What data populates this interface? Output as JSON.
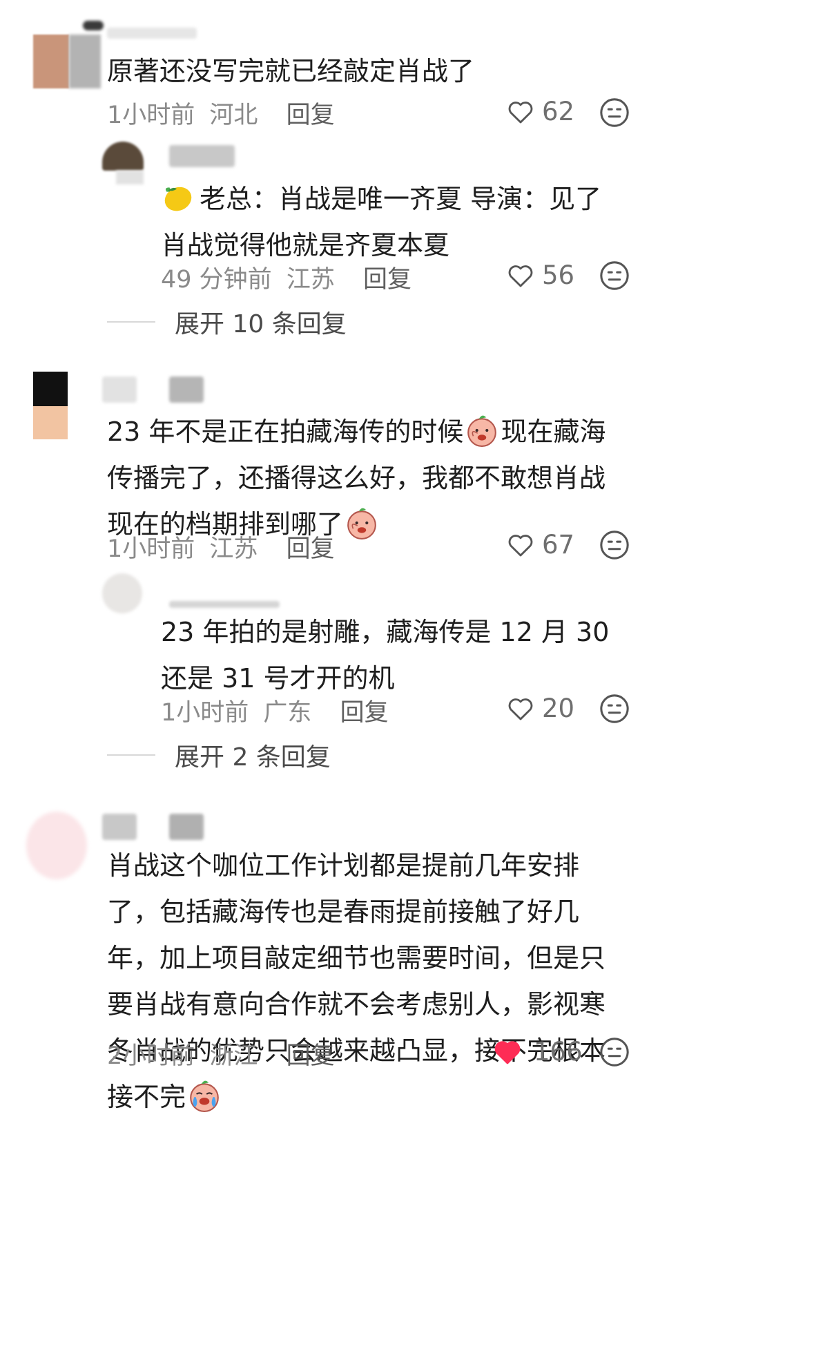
{
  "comments": [
    {
      "text": "原著还没写完就已经敲定肖战了",
      "time": "1小时前",
      "location": "河北",
      "reply": "回复",
      "likes": "62",
      "liked": false,
      "replies": [
        {
          "text_prefix": "",
          "text": "老总：肖战是唯一齐夏 导演：见了肖战觉得他就是齐夏本夏",
          "time": "49 分钟前",
          "location": "江苏",
          "reply": "回复",
          "likes": "56",
          "liked": false
        }
      ],
      "expand": "展开 10 条回复"
    },
    {
      "text_part1": "23 年不是正在拍藏海传的时候",
      "text_part2": "现在藏海传播完了，还播得这么好，我都不敢想肖战现在的档期排到哪了",
      "time": "1小时前",
      "location": "江苏",
      "reply": "回复",
      "likes": "67",
      "liked": false,
      "replies": [
        {
          "text": "23 年拍的是射雕，藏海传是 12 月 30 还是 31 号才开的机",
          "time": "1小时前",
          "location": "广东",
          "reply": "回复",
          "likes": "20",
          "liked": false
        }
      ],
      "expand": "展开 2 条回复"
    },
    {
      "text": "肖战这个咖位工作计划都是提前几年安排了，包括藏海传也是春雨提前接触了好几年，加上项目敲定细节也需要时间，但是只要肖战有意向合作就不会考虑别人，影视寒冬肖战的优势只会越来越凸显，接不完根本接不完",
      "time": "2小时前",
      "location": "浙江",
      "reply": "回复",
      "likes": "166",
      "liked": true
    }
  ],
  "colors": {
    "liked_heart": "#fe2c55",
    "meta": "#8a8a8a"
  }
}
